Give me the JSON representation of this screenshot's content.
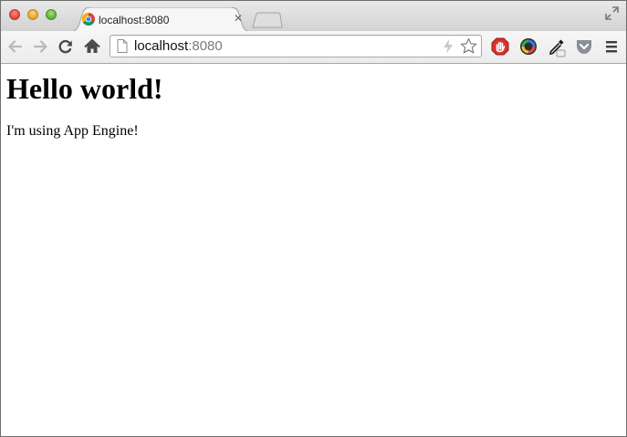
{
  "browser": {
    "tab": {
      "title": "localhost:8080",
      "favicon": "chrome-logo-icon",
      "close_icon": "close-icon"
    },
    "toolbar": {
      "back_icon": "back-arrow-icon",
      "forward_icon": "forward-arrow-icon",
      "reload_icon": "reload-icon",
      "home_icon": "home-icon",
      "address_host": "localhost",
      "address_port": ":8080",
      "extensions": [
        "adblock-icon",
        "color-wheel-icon",
        "eyedropper-icon",
        "pocket-icon"
      ],
      "menu_icon": "hamburger-menu-icon"
    },
    "colors": {
      "adblock_red": "#d9302c",
      "pocket_gray": "#8a8f96"
    }
  },
  "page": {
    "heading": "Hello world!",
    "paragraph": "I'm using App Engine!"
  }
}
